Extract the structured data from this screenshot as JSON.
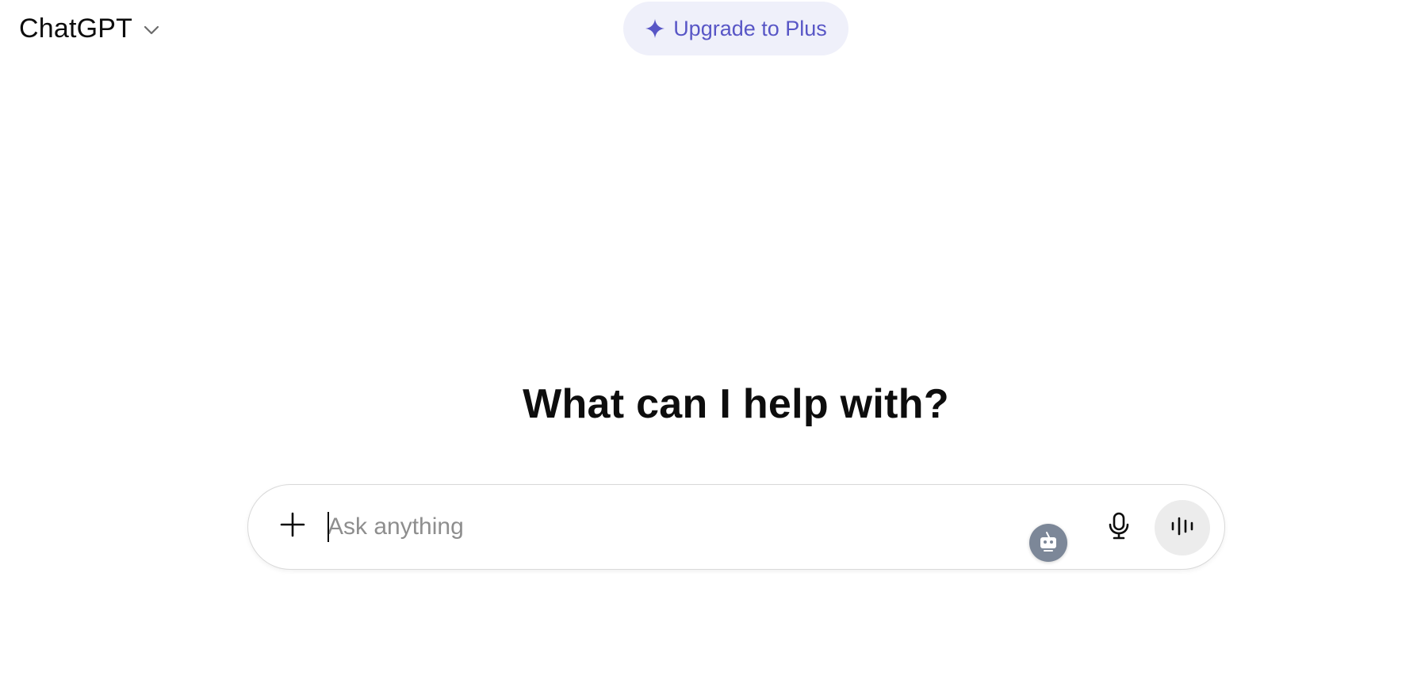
{
  "header": {
    "model_name": "ChatGPT",
    "model_dropdown_icon": "chevron-down-icon"
  },
  "upgrade": {
    "label": "Upgrade to Plus",
    "icon": "sparkle-icon",
    "accent_color": "#5856c6",
    "background_color": "#eff0fa"
  },
  "main": {
    "headline": "What can I help with?"
  },
  "composer": {
    "placeholder": "Ask anything",
    "value": "",
    "attach_icon": "plus-icon",
    "dictate_icon": "microphone-icon",
    "voice_mode_icon": "voice-waveform-icon"
  },
  "floating_widget": {
    "icon": "robot-icon",
    "background_color": "#7c8798"
  }
}
